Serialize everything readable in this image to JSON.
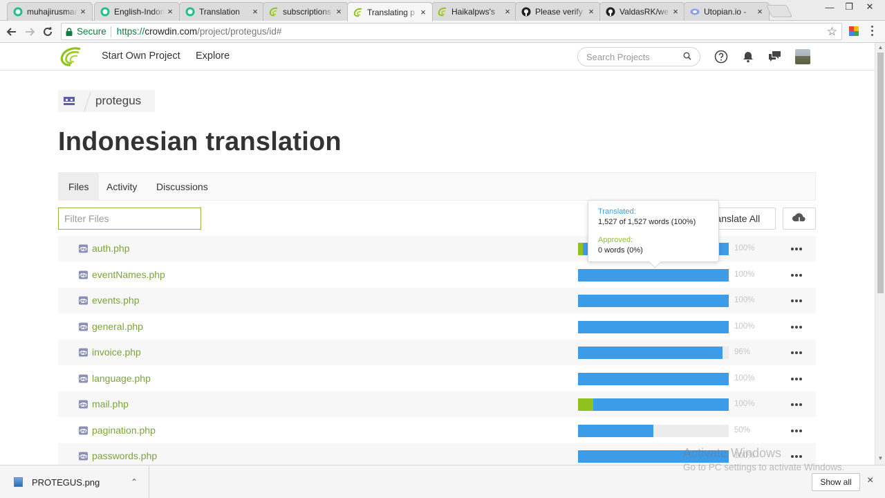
{
  "browser": {
    "tabs": [
      {
        "title": "muhajirusman",
        "favicon": "steemit-icon"
      },
      {
        "title": "English-Indonesian",
        "favicon": "steemit-icon"
      },
      {
        "title": "Translation",
        "favicon": "steemit-icon"
      },
      {
        "title": "subscriptions",
        "favicon": "crowdin-icon"
      },
      {
        "title": "Translating p",
        "favicon": "crowdin-icon",
        "active": true
      },
      {
        "title": "Haikalpws's",
        "favicon": "crowdin-icon"
      },
      {
        "title": "Please verify",
        "favicon": "github-icon"
      },
      {
        "title": "ValdasRK/we",
        "favicon": "github-icon"
      },
      {
        "title": "Utopian.io -",
        "favicon": "utopian-icon"
      }
    ],
    "close_glyph": "×",
    "secure_label": "Secure",
    "url_scheme": "https://",
    "url_host": "crowdin.com",
    "url_path": "/project/protegus/id#"
  },
  "header": {
    "nav": [
      "Start Own Project",
      "Explore"
    ],
    "search_placeholder": "Search Projects"
  },
  "breadcrumb": {
    "project": "protegus"
  },
  "page": {
    "title": "Indonesian translation"
  },
  "tabs": [
    "Files",
    "Activity",
    "Discussions"
  ],
  "filter": {
    "placeholder": "Filter Files"
  },
  "actions": {
    "translate_all": "Translate All"
  },
  "files": [
    {
      "name": "auth.php",
      "translated": 100,
      "approved": 3,
      "percent_label": "100%"
    },
    {
      "name": "eventNames.php",
      "translated": 100,
      "approved": 0,
      "percent_label": "100%"
    },
    {
      "name": "events.php",
      "translated": 100,
      "approved": 0,
      "percent_label": "100%"
    },
    {
      "name": "general.php",
      "translated": 100,
      "approved": 0,
      "percent_label": "100%"
    },
    {
      "name": "invoice.php",
      "translated": 96,
      "approved": 0,
      "percent_label": "96%"
    },
    {
      "name": "language.php",
      "translated": 100,
      "approved": 0,
      "percent_label": "100%"
    },
    {
      "name": "mail.php",
      "translated": 100,
      "approved": 10,
      "percent_label": "100%"
    },
    {
      "name": "pagination.php",
      "translated": 50,
      "approved": 0,
      "percent_label": "50%"
    },
    {
      "name": "passwords.php",
      "translated": 100,
      "approved": 0,
      "percent_label": "100%"
    }
  ],
  "tooltip": {
    "translated_label": "Translated:",
    "translated_value": "1,527 of 1,527 words (100%)",
    "approved_label": "Approved:",
    "approved_value": "0 words (0%)"
  },
  "watermark": {
    "line1": "Activate Windows",
    "line2": "Go to PC settings to activate Windows."
  },
  "downloads": {
    "file": "PROTEGUS.png",
    "show_all": "Show all",
    "close_glyph": "×"
  },
  "colors": {
    "brand_green": "#7ca33a",
    "translated_blue": "#3d9ce8",
    "approved_green": "#8fc21d"
  }
}
